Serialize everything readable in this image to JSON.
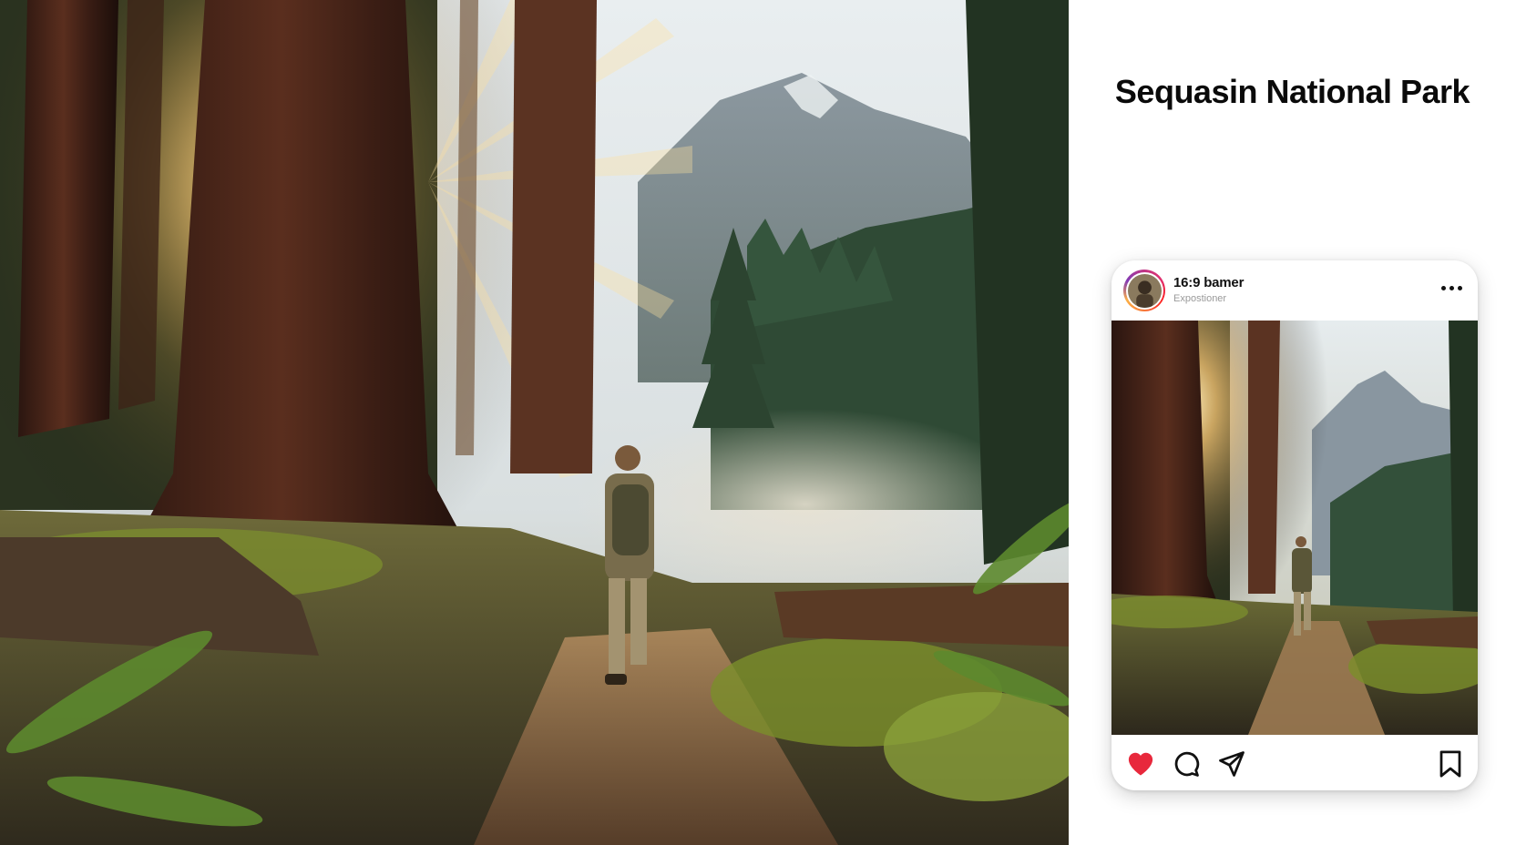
{
  "page": {
    "title": "Sequasin National Park"
  },
  "post": {
    "username": "16:9 bamer",
    "subtitle": "Expostioner",
    "liked": true,
    "colors": {
      "like": "#e8283c",
      "icon": "#111111"
    }
  },
  "icons": {
    "more": "more-horizontal-icon",
    "like": "heart-icon",
    "comment": "comment-icon",
    "share": "send-icon",
    "save": "bookmark-icon"
  }
}
